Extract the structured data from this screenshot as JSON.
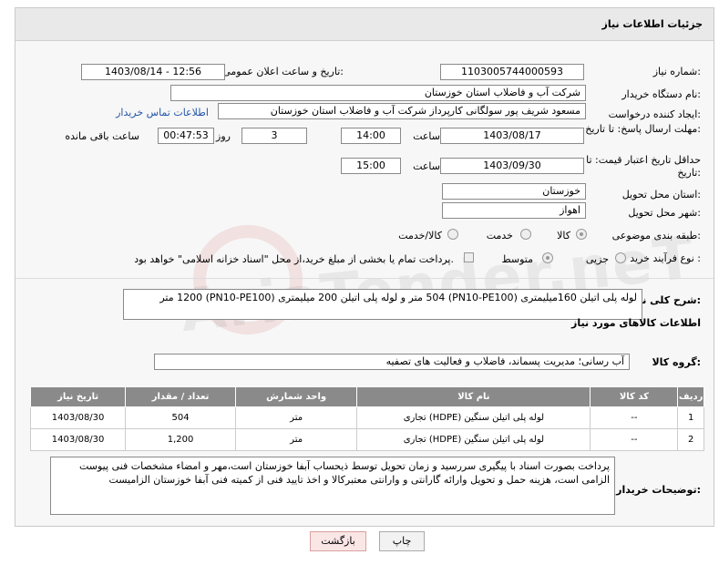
{
  "header": {
    "title": "جزئیات اطلاعات نیاز"
  },
  "form": {
    "need_number_label": "شماره نیاز:",
    "need_number": "1103005744000593",
    "announce_label": "تاریخ و ساعت اعلان عمومی:",
    "announce_value": "1403/08/14 - 12:56",
    "buyer_org_label": "نام دستگاه خریدار:",
    "buyer_org": "شرکت آب و فاضلاب استان خوزستان",
    "creator_label": "ایجاد کننده درخواست:",
    "creator": "مسعود شریف پور سولگانی کارپرداز شرکت آب و فاضلاب استان خوزستان",
    "contact_link": "اطلاعات تماس خریدار",
    "send_deadline_label": "مهلت ارسال پاسخ: تا تاریخ:",
    "send_date": "1403/08/17",
    "time_word": "ساعت",
    "send_time": "14:00",
    "days": "3",
    "days_and": "روز و",
    "remaining": "00:47:53",
    "remaining_label": "ساعت باقی مانده",
    "validity_label": "حداقل تاریخ اعتبار قیمت: تا تاریخ:",
    "validity_date": "1403/09/30",
    "validity_time": "15:00",
    "province_label": "استان محل تحویل:",
    "province": "خوزستان",
    "city_label": "شهر محل تحویل:",
    "city": "اهواز",
    "category_label": "طبقه بندی موضوعی:",
    "cat_goods": "کالا",
    "cat_service": "خدمت",
    "cat_goods_service": "کالا/خدمت",
    "process_label": "نوع فرآیند خرید :",
    "proc_partial": "جزیی",
    "proc_medium": "متوسط",
    "payment_note": "پرداخت تمام یا بخشی از مبلغ خرید،از محل \"اسناد خزانه اسلامی\" خواهد بود."
  },
  "description": {
    "label": "شرح کلی نیاز:",
    "text": "لوله پلی اتیلن 160میلیمتری (PN10-PE100) 504 متر و لوله پلی اتیلن 200 میلیمتری (PN10-PE100) 1200 متر"
  },
  "goods": {
    "section_title": "اطلاعات کالاهای مورد نیاز",
    "group_label": "گروه کالا:",
    "group_value": "آب رسانی؛ مدیریت پسماند، فاضلاب و فعالیت های تصفیه",
    "columns": [
      "ردیف",
      "کد کالا",
      "نام کالا",
      "واحد شمارش",
      "تعداد / مقدار",
      "تاریخ نیاز"
    ],
    "rows": [
      [
        "1",
        "--",
        "لوله پلی اتیلن سنگین (HDPE) تجاری",
        "متر",
        "504",
        "1403/08/30"
      ],
      [
        "2",
        "--",
        "لوله پلی اتیلن سنگین (HDPE) تجاری",
        "متر",
        "1,200",
        "1403/08/30"
      ]
    ]
  },
  "buyer_notes": {
    "label": "توضیحات خریدار:",
    "text": "پرداخت بصورت اسناد با پیگیری  سررسید و زمان تحویل توسط ذیحساب آبفا خوزستان است،مهر و امضاء مشخصات فنی پیوست الزامی است، هزینه حمل و تحویل وارائه گارانتی و وارانتی معتبرکالا و اخذ تایید فنی از کمیته فنی آبفا خوزستان الزامیست"
  },
  "buttons": {
    "print": "چاپ",
    "back": "بازگشت"
  },
  "watermark": "AriaTender.neT"
}
